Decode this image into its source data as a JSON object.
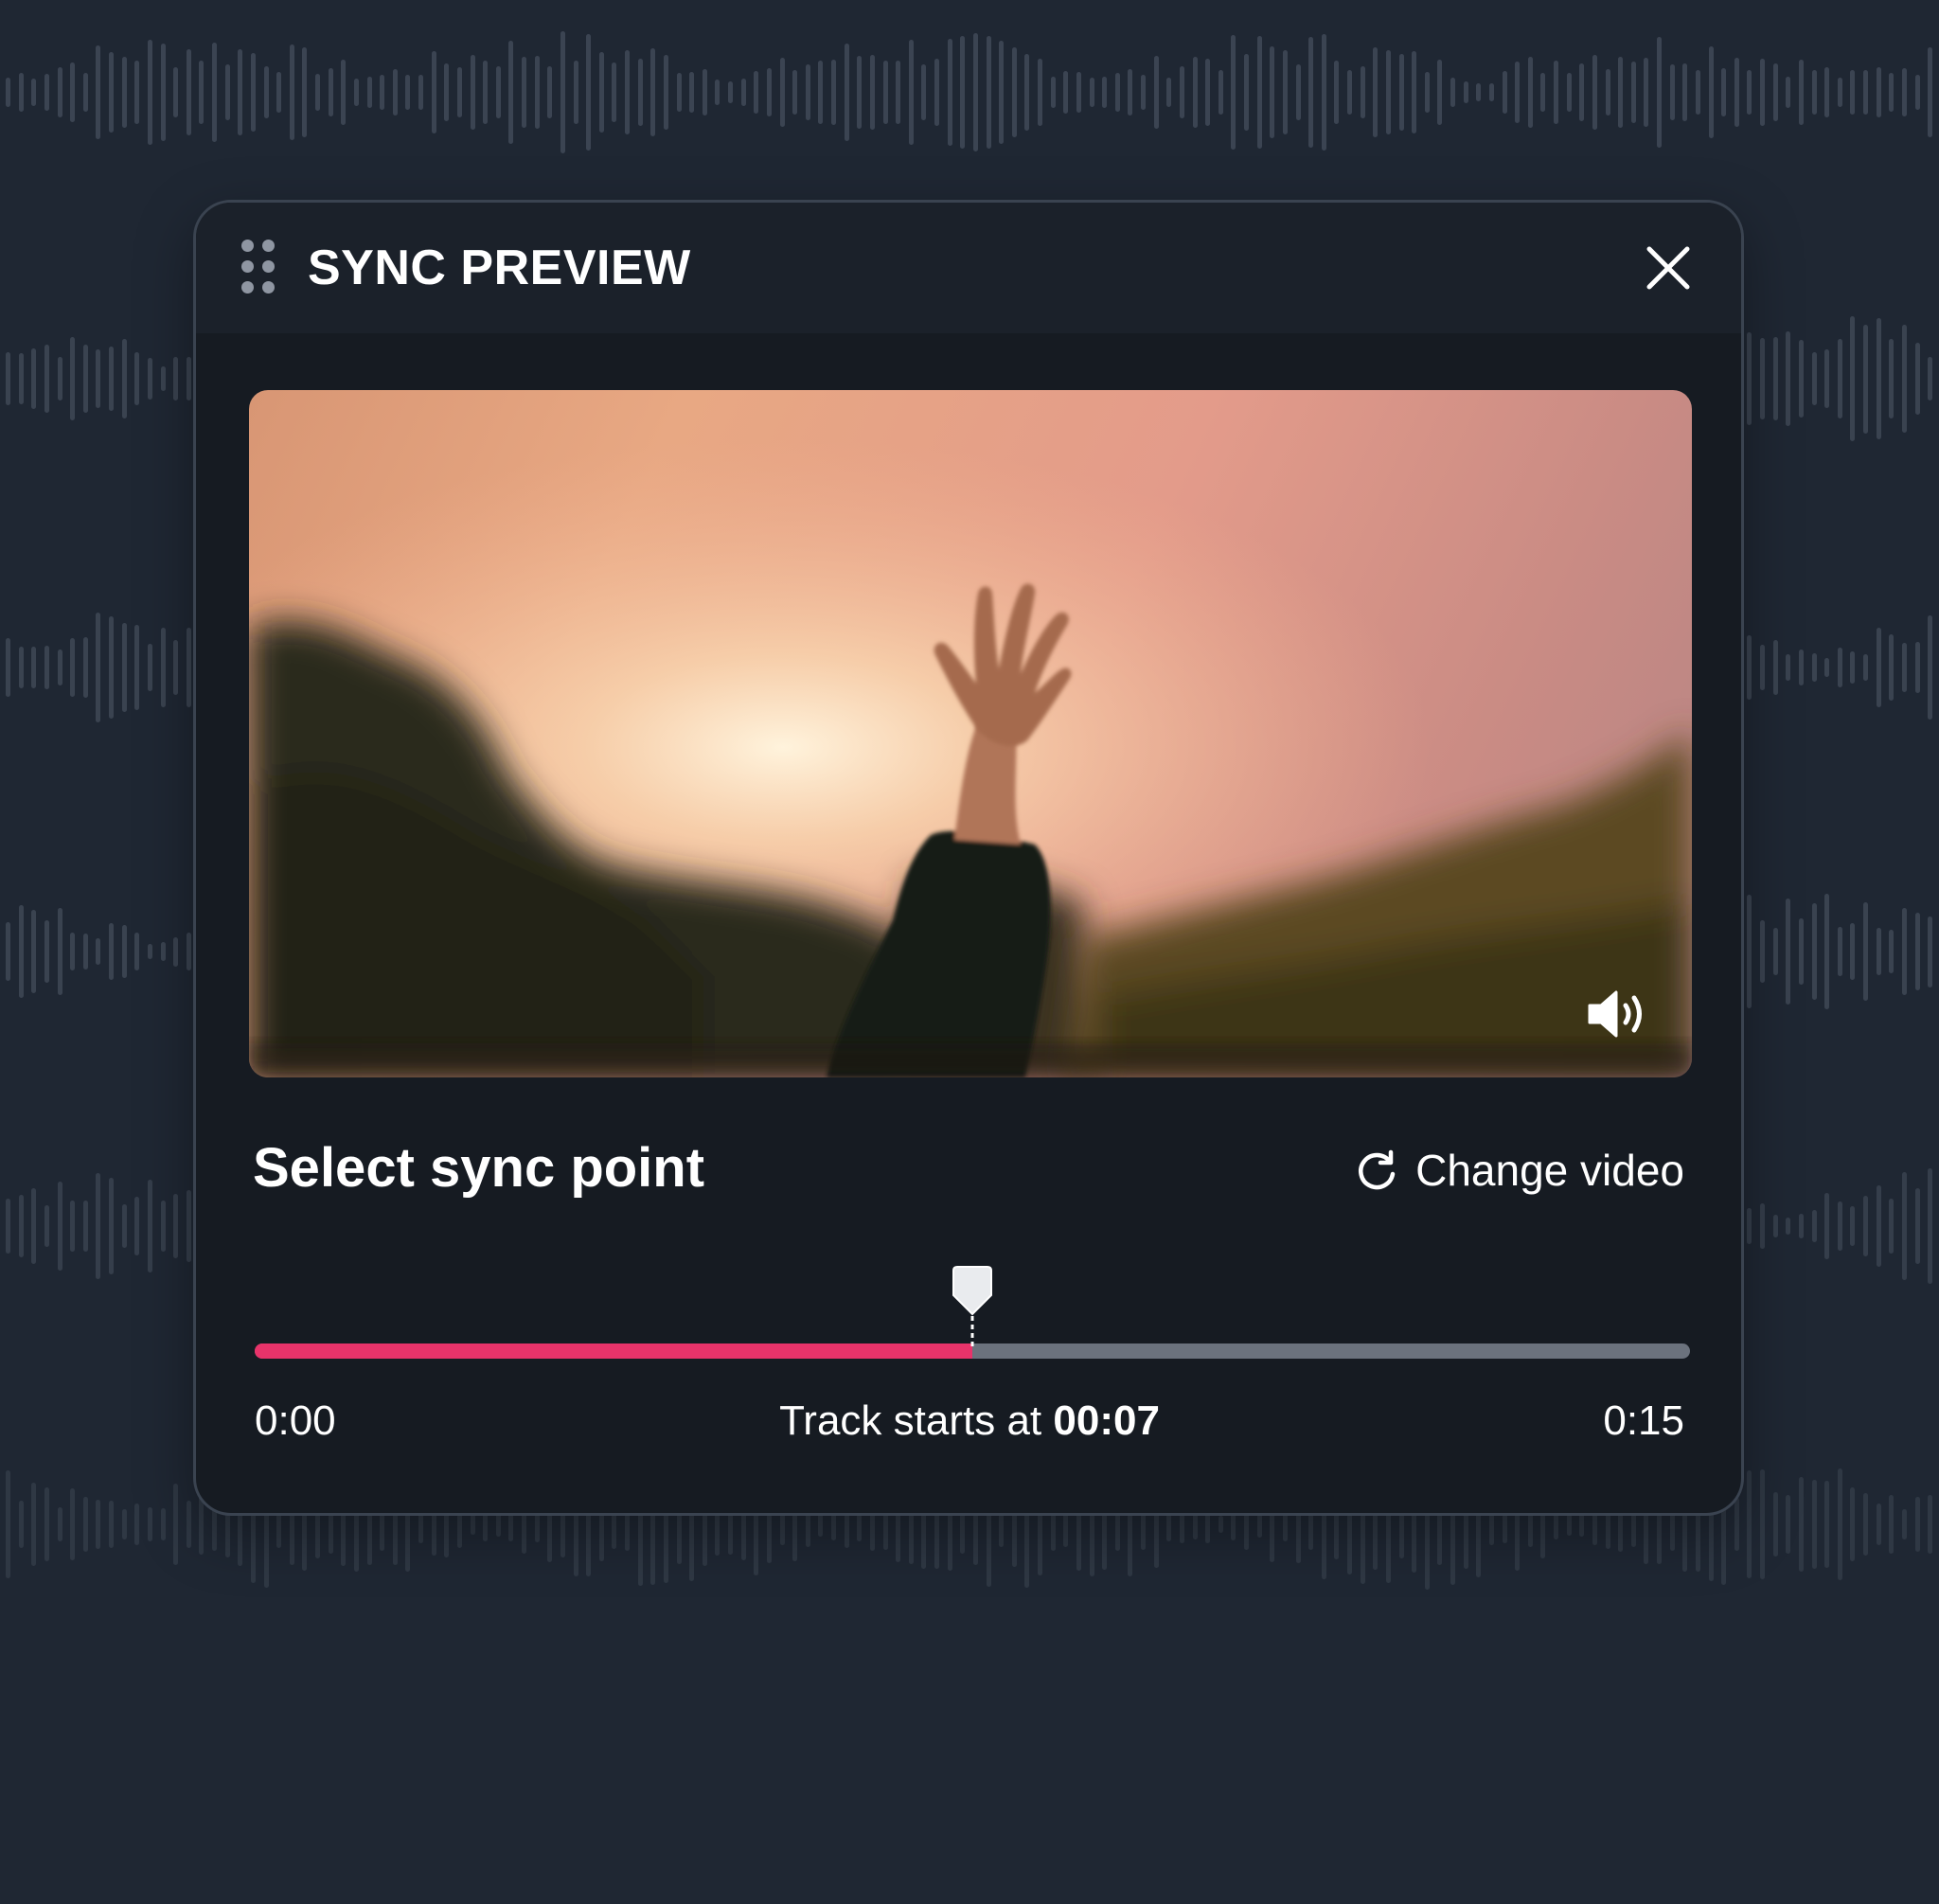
{
  "dialog": {
    "title": "SYNC PREVIEW",
    "close_icon": "close-icon",
    "drag_icon": "drag-handle-icon"
  },
  "video": {
    "volume_icon": "volume-icon"
  },
  "sync": {
    "title": "Select sync point",
    "change_video_label": "Change video",
    "change_video_icon": "refresh-icon",
    "start_time": "0:00",
    "end_time": "0:15",
    "track_starts_prefix": "Track starts at",
    "track_starts_value": "00:07",
    "progress": 0.5,
    "accent_color": "#e8336a"
  }
}
